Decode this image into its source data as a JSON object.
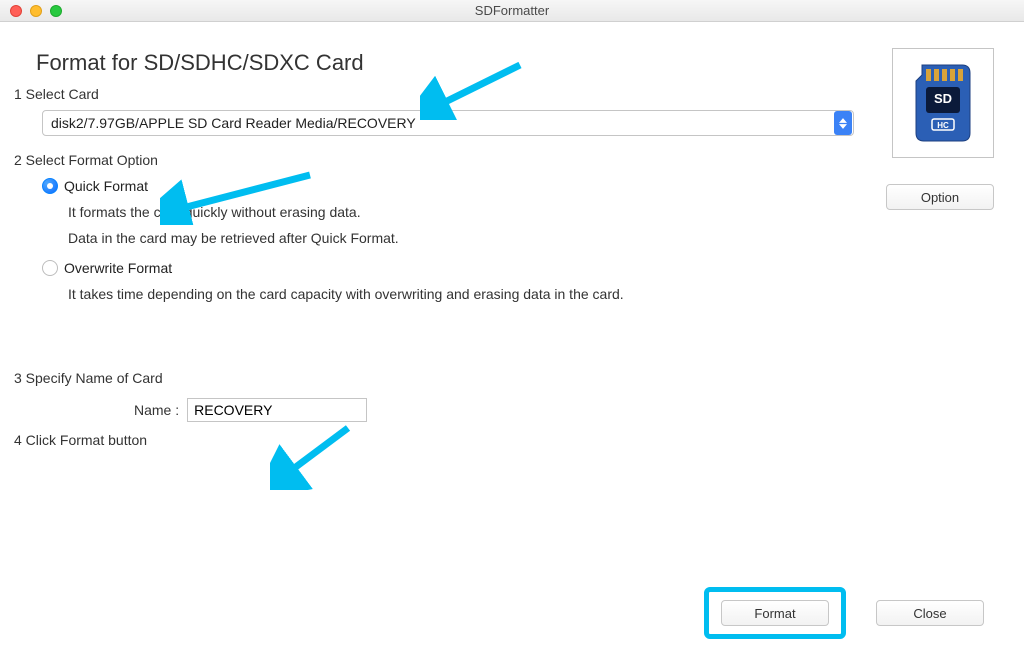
{
  "window": {
    "title": "SDFormatter"
  },
  "heading": "Format for SD/SDHC/SDXC Card",
  "steps": {
    "s1": "1 Select Card",
    "s2": "2 Select Format Option",
    "s3": "3 Specify Name of Card",
    "s4": "4 Click Format button"
  },
  "card_select": {
    "selected": "disk2/7.97GB/APPLE SD Card Reader Media/RECOVERY"
  },
  "option_button": "Option",
  "format_options": {
    "quick": {
      "label": "Quick Format",
      "desc1": "It formats the card quickly without erasing data.",
      "desc2": "Data in the card may be retrieved after Quick Format.",
      "selected": true
    },
    "overwrite": {
      "label": "Overwrite Format",
      "desc1": "It takes time depending on the card capacity with overwriting and erasing data in the card.",
      "selected": false
    }
  },
  "name_field": {
    "label": "Name :",
    "value": "RECOVERY"
  },
  "buttons": {
    "format": "Format",
    "close": "Close"
  },
  "annotation_color": "#00bdf0"
}
